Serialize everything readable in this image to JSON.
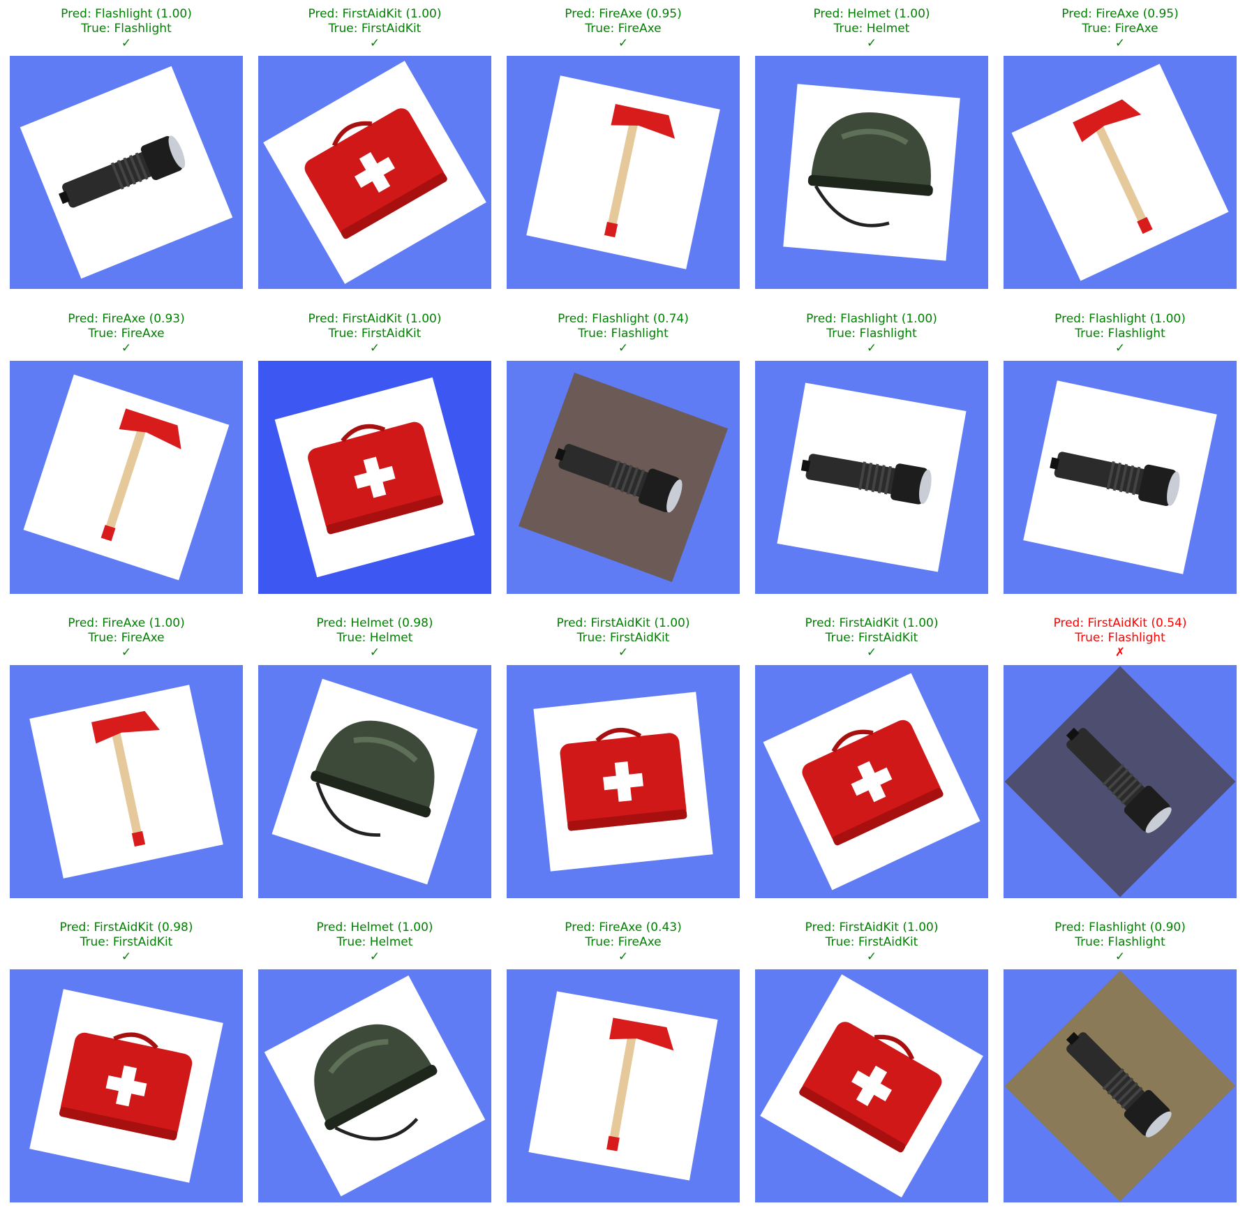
{
  "colors": {
    "correct": "#008000",
    "wrong": "#ff0000",
    "background": "#5f7cf5",
    "background_deep": "#3d57f2"
  },
  "panels": [
    {
      "pred": "Pred: Flashlight (1.00)",
      "true": "True: Flashlight",
      "mark": "✓",
      "correct": true,
      "object": "flashlight-icon"
    },
    {
      "pred": "Pred: FirstAidKit (1.00)",
      "true": "True: FirstAidKit",
      "mark": "✓",
      "correct": true,
      "object": "first-aid-kit-icon"
    },
    {
      "pred": "Pred: FireAxe (0.95)",
      "true": "True: FireAxe",
      "mark": "✓",
      "correct": true,
      "object": "fire-axe-icon"
    },
    {
      "pred": "Pred: Helmet (1.00)",
      "true": "True: Helmet",
      "mark": "✓",
      "correct": true,
      "object": "helmet-icon"
    },
    {
      "pred": "Pred: FireAxe (0.95)",
      "true": "True: FireAxe",
      "mark": "✓",
      "correct": true,
      "object": "fire-axe-icon"
    },
    {
      "pred": "Pred: FireAxe (0.93)",
      "true": "True: FireAxe",
      "mark": "✓",
      "correct": true,
      "object": "fire-axe-icon"
    },
    {
      "pred": "Pred: FirstAidKit (1.00)",
      "true": "True: FirstAidKit",
      "mark": "✓",
      "correct": true,
      "object": "first-aid-kit-icon"
    },
    {
      "pred": "Pred: Flashlight (0.74)",
      "true": "True: Flashlight",
      "mark": "✓",
      "correct": true,
      "object": "flashlight-icon"
    },
    {
      "pred": "Pred: Flashlight (1.00)",
      "true": "True: Flashlight",
      "mark": "✓",
      "correct": true,
      "object": "flashlight-icon"
    },
    {
      "pred": "Pred: Flashlight (1.00)",
      "true": "True: Flashlight",
      "mark": "✓",
      "correct": true,
      "object": "flashlight-icon"
    },
    {
      "pred": "Pred: FireAxe (1.00)",
      "true": "True: FireAxe",
      "mark": "✓",
      "correct": true,
      "object": "fire-axe-icon"
    },
    {
      "pred": "Pred: Helmet (0.98)",
      "true": "True: Helmet",
      "mark": "✓",
      "correct": true,
      "object": "helmet-icon"
    },
    {
      "pred": "Pred: FirstAidKit (1.00)",
      "true": "True: FirstAidKit",
      "mark": "✓",
      "correct": true,
      "object": "first-aid-kit-icon"
    },
    {
      "pred": "Pred: FirstAidKit (1.00)",
      "true": "True: FirstAidKit",
      "mark": "✓",
      "correct": true,
      "object": "first-aid-kit-icon"
    },
    {
      "pred": "Pred: FirstAidKit (0.54)",
      "true": "True: Flashlight",
      "mark": "✗",
      "correct": false,
      "object": "flashlight-icon"
    },
    {
      "pred": "Pred: FirstAidKit (0.98)",
      "true": "True: FirstAidKit",
      "mark": "✓",
      "correct": true,
      "object": "first-aid-kit-icon"
    },
    {
      "pred": "Pred: Helmet (1.00)",
      "true": "True: Helmet",
      "mark": "✓",
      "correct": true,
      "object": "helmet-icon"
    },
    {
      "pred": "Pred: FireAxe (0.43)",
      "true": "True: FireAxe",
      "mark": "✓",
      "correct": true,
      "object": "fire-axe-icon"
    },
    {
      "pred": "Pred: FirstAidKit (1.00)",
      "true": "True: FirstAidKit",
      "mark": "✓",
      "correct": true,
      "object": "first-aid-kit-icon"
    },
    {
      "pred": "Pred: Flashlight (0.90)",
      "true": "True: Flashlight",
      "mark": "✓",
      "correct": true,
      "object": "flashlight-icon"
    }
  ]
}
